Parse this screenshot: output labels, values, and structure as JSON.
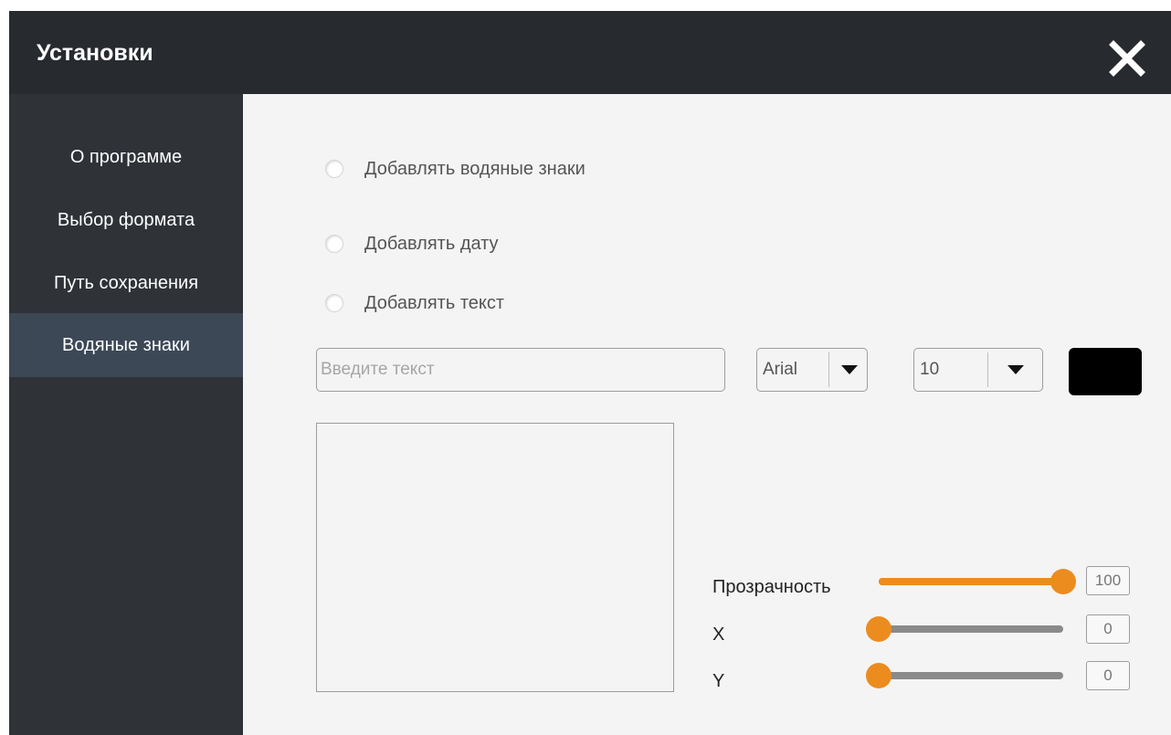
{
  "window": {
    "title": "Установки",
    "close_icon": "close-icon"
  },
  "sidebar": {
    "items": [
      {
        "label": "О программе",
        "active": false
      },
      {
        "label": "Выбор формата",
        "active": false
      },
      {
        "label": "Путь сохранения",
        "active": false
      },
      {
        "label": "Водяные знаки",
        "active": true
      }
    ]
  },
  "options": {
    "add_watermarks": "Добавлять водяные знаки",
    "add_date": "Добавлять дату",
    "add_text": "Добавлять текст"
  },
  "text_input": {
    "placeholder": "Введите текст",
    "value": ""
  },
  "font_select": {
    "value": "Arial",
    "icon": "caret-down-icon"
  },
  "size_select": {
    "value": "10",
    "icon": "caret-down-icon"
  },
  "text_color": "#000000",
  "accent_color": "#ec8c1e",
  "sliders": {
    "opacity": {
      "label": "Прозрачность",
      "value": "100",
      "fraction": 1.0
    },
    "x": {
      "label": "X",
      "value": "0",
      "fraction": 0.0
    },
    "y": {
      "label": "Y",
      "value": "0",
      "fraction": 0.0
    }
  }
}
